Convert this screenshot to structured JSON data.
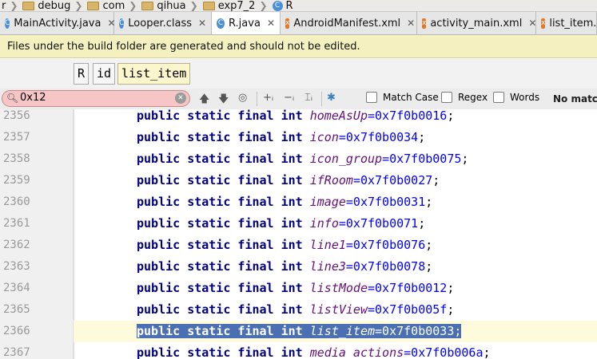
{
  "breadcrumbs": [
    "r",
    "debug",
    "com",
    "qihua",
    "exp7_2",
    "R"
  ],
  "tabs": [
    {
      "label": "MainActivity.java",
      "icon": "c"
    },
    {
      "label": "Looper.class",
      "icon": "c"
    },
    {
      "label": "R.java",
      "icon": "c"
    },
    {
      "label": "AndroidManifest.xml",
      "icon": "xml"
    },
    {
      "label": "activity_main.xml",
      "icon": "xml"
    },
    {
      "label": "list_item.x",
      "icon": "xml"
    }
  ],
  "notice": "Files under the build folder are generated and should not be edited.",
  "tagbar": {
    "tag1": "R",
    "tag2": "id",
    "tag3": "list_item"
  },
  "find": {
    "value": "0x12",
    "match_case": "Match Case",
    "regex": "Regex",
    "words": "Words",
    "status": "No matche"
  },
  "code": {
    "prefix": "public static final int ",
    "lines": [
      {
        "num": "2356",
        "field": "homeAsUp",
        "value": "=0x7f0b0016",
        "end": ";"
      },
      {
        "num": "2357",
        "field": "icon",
        "value": "=0x7f0b0034",
        "end": ";"
      },
      {
        "num": "2358",
        "field": "icon_group",
        "value": "=0x7f0b0075",
        "end": ";"
      },
      {
        "num": "2359",
        "field": "ifRoom",
        "value": "=0x7f0b0027",
        "end": ";"
      },
      {
        "num": "2360",
        "field": "image",
        "value": "=0x7f0b0031",
        "end": ";"
      },
      {
        "num": "2361",
        "field": "info",
        "value": "=0x7f0b0071",
        "end": ";"
      },
      {
        "num": "2362",
        "field": "line1",
        "value": "=0x7f0b0076",
        "end": ";"
      },
      {
        "num": "2363",
        "field": "line3",
        "value": "=0x7f0b0078",
        "end": ";"
      },
      {
        "num": "2364",
        "field": "listMode",
        "value": "=0x7f0b0012",
        "end": ";"
      },
      {
        "num": "2365",
        "field": "listView",
        "value": "=0x7f0b005f",
        "end": ";"
      },
      {
        "num": "2366",
        "field": "list_item",
        "value": "=0x7f0b0033",
        "end": ";"
      },
      {
        "num": "2367",
        "field": "media_actions",
        "value": "=0x7f0b006a",
        "end": ";"
      }
    ]
  },
  "colors": {
    "keyword": "#000080",
    "field": "#660e7a",
    "number": "#0000ff",
    "selection": "#4a6fb3",
    "search_no_match": "#f6c6c6"
  }
}
